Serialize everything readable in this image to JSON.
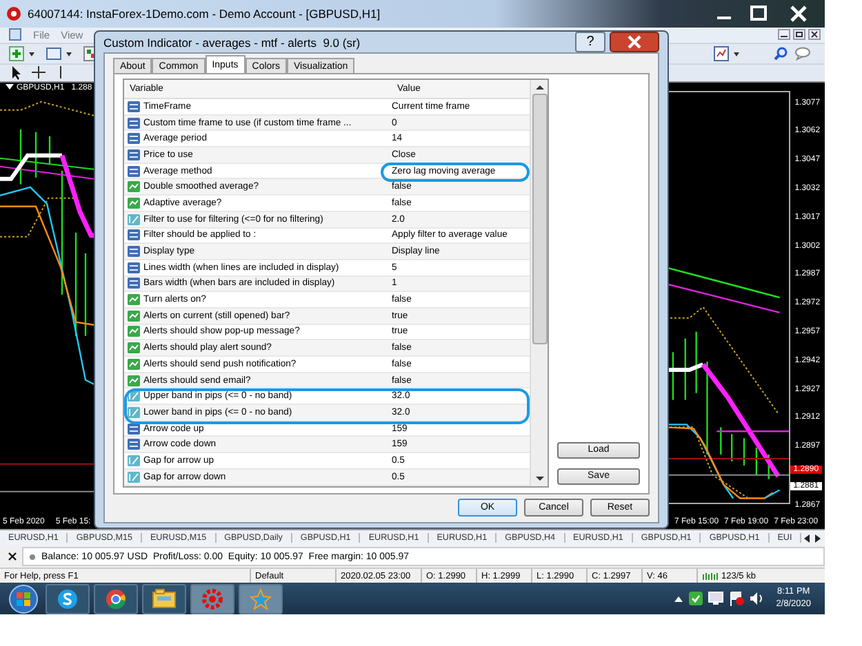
{
  "main_window": {
    "title": "64007144: InstaForex-1Demo.com - Demo Account - [GBPUSD,H1]",
    "menu": [
      "File",
      "View"
    ]
  },
  "left_chart": {
    "header": "GBPUSD,H1",
    "price": "1.288",
    "dates": [
      "5 Feb 2020",
      "5 Feb 15:"
    ]
  },
  "right_chart": {
    "dates": [
      "7 Feb 15:00",
      "7 Feb 19:00",
      "7 Feb 23:00"
    ],
    "price_axis": [
      "1.3077",
      "1.3062",
      "1.3047",
      "1.3032",
      "1.3017",
      "1.3002",
      "1.2987",
      "1.2972",
      "1.2957",
      "1.2942",
      "1.2927",
      "1.2912",
      "1.2897",
      "1.2867"
    ],
    "price_markers": [
      {
        "label": "1.2890",
        "kind": "bid"
      },
      {
        "label": "1.2881",
        "kind": "last"
      }
    ]
  },
  "chart_tabs": [
    "EURUSD,H1",
    "GBPUSD,M15",
    "EURUSD,M15",
    "GBPUSD,Daily",
    "GBPUSD,H1",
    "EURUSD,H1",
    "EURUSD,H1",
    "GBPUSD,H4",
    "EURUSD,H1",
    "GBPUSD,H1",
    "GBPUSD,H1",
    "EUI"
  ],
  "terminal": {
    "balance": "Balance: 10 005.97 USD  Profit/Loss: 0.00  Equity: 10 005.97  Free margin: 10 005.97"
  },
  "status_bar": [
    "For Help, press F1",
    "Default",
    "2020.02.05 23:00",
    "O: 1.2990",
    "H: 1.2999",
    "L: 1.2990",
    "C: 1.2997",
    "V: 46",
    "123/5 kb"
  ],
  "taskbar": {
    "time": "8:11 PM",
    "date": "2/8/2020"
  },
  "dialog": {
    "title": "Custom Indicator - averages - mtf - alerts  9.0 (sr)",
    "help": "?",
    "tabs": [
      {
        "label": "About",
        "selected": false
      },
      {
        "label": "Common",
        "selected": false
      },
      {
        "label": "Inputs",
        "selected": true
      },
      {
        "label": "Colors",
        "selected": false
      },
      {
        "label": "Visualization",
        "selected": false
      }
    ],
    "columns": [
      "Variable",
      "Value"
    ],
    "rows": [
      {
        "kind": "int",
        "variable": "TimeFrame",
        "value": "Current time frame",
        "value_circled": false,
        "row_circled": false
      },
      {
        "kind": "int",
        "variable": "Custom time frame to use (if custom time frame ...",
        "value": "0",
        "value_circled": false,
        "row_circled": false
      },
      {
        "kind": "int",
        "variable": "Average period",
        "value": "14",
        "value_circled": false,
        "row_circled": false
      },
      {
        "kind": "int",
        "variable": "Price to use",
        "value": "Close",
        "value_circled": false,
        "row_circled": false
      },
      {
        "kind": "int",
        "variable": "Average method",
        "value": "Zero lag moving average",
        "value_circled": true,
        "row_circled": false
      },
      {
        "kind": "bool",
        "variable": "Double smoothed average?",
        "value": "false",
        "value_circled": false,
        "row_circled": false
      },
      {
        "kind": "bool",
        "variable": "Adaptive average?",
        "value": "false",
        "value_circled": false,
        "row_circled": false
      },
      {
        "kind": "double",
        "variable": "Filter to use for filtering (<=0 for no filtering)",
        "value": "2.0",
        "value_circled": false,
        "row_circled": false
      },
      {
        "kind": "int",
        "variable": "Filter should be applied to :",
        "value": "Apply filter to average value",
        "value_circled": false,
        "row_circled": false
      },
      {
        "kind": "int",
        "variable": "Display type",
        "value": "Display line",
        "value_circled": false,
        "row_circled": false
      },
      {
        "kind": "int",
        "variable": "Lines width (when lines are included in display)",
        "value": "5",
        "value_circled": false,
        "row_circled": false
      },
      {
        "kind": "int",
        "variable": "Bars width (when bars are included in display)",
        "value": "1",
        "value_circled": false,
        "row_circled": false
      },
      {
        "kind": "bool",
        "variable": "Turn alerts on?",
        "value": "false",
        "value_circled": false,
        "row_circled": false
      },
      {
        "kind": "bool",
        "variable": "Alerts on current (still opened) bar?",
        "value": "true",
        "value_circled": false,
        "row_circled": false
      },
      {
        "kind": "bool",
        "variable": "Alerts should show pop-up message?",
        "value": "true",
        "value_circled": false,
        "row_circled": false
      },
      {
        "kind": "bool",
        "variable": "Alerts should play alert sound?",
        "value": "false",
        "value_circled": false,
        "row_circled": false
      },
      {
        "kind": "bool",
        "variable": "Alerts should send push notification?",
        "value": "false",
        "value_circled": false,
        "row_circled": false
      },
      {
        "kind": "bool",
        "variable": "Alerts should send email?",
        "value": "false",
        "value_circled": false,
        "row_circled": false
      },
      {
        "kind": "double",
        "variable": "Upper band in pips (<= 0 - no band)",
        "value": "32.0",
        "value_circled": false,
        "row_circled": true
      },
      {
        "kind": "double",
        "variable": "Lower band in pips (<= 0 - no band)",
        "value": "32.0",
        "value_circled": false,
        "row_circled": true
      },
      {
        "kind": "int",
        "variable": "Arrow code up",
        "value": "159",
        "value_circled": false,
        "row_circled": false
      },
      {
        "kind": "int",
        "variable": "Arrow code down",
        "value": "159",
        "value_circled": false,
        "row_circled": false
      },
      {
        "kind": "double",
        "variable": "Gap for arrow up",
        "value": "0.5",
        "value_circled": false,
        "row_circled": false
      },
      {
        "kind": "double",
        "variable": "Gap for arrow down",
        "value": "0.5",
        "value_circled": false,
        "row_circled": false
      }
    ],
    "side_buttons": [
      "Load",
      "Save"
    ],
    "buttons": [
      {
        "label": "OK",
        "default": true
      },
      {
        "label": "Cancel",
        "default": false
      },
      {
        "label": "Reset",
        "default": false
      }
    ]
  }
}
